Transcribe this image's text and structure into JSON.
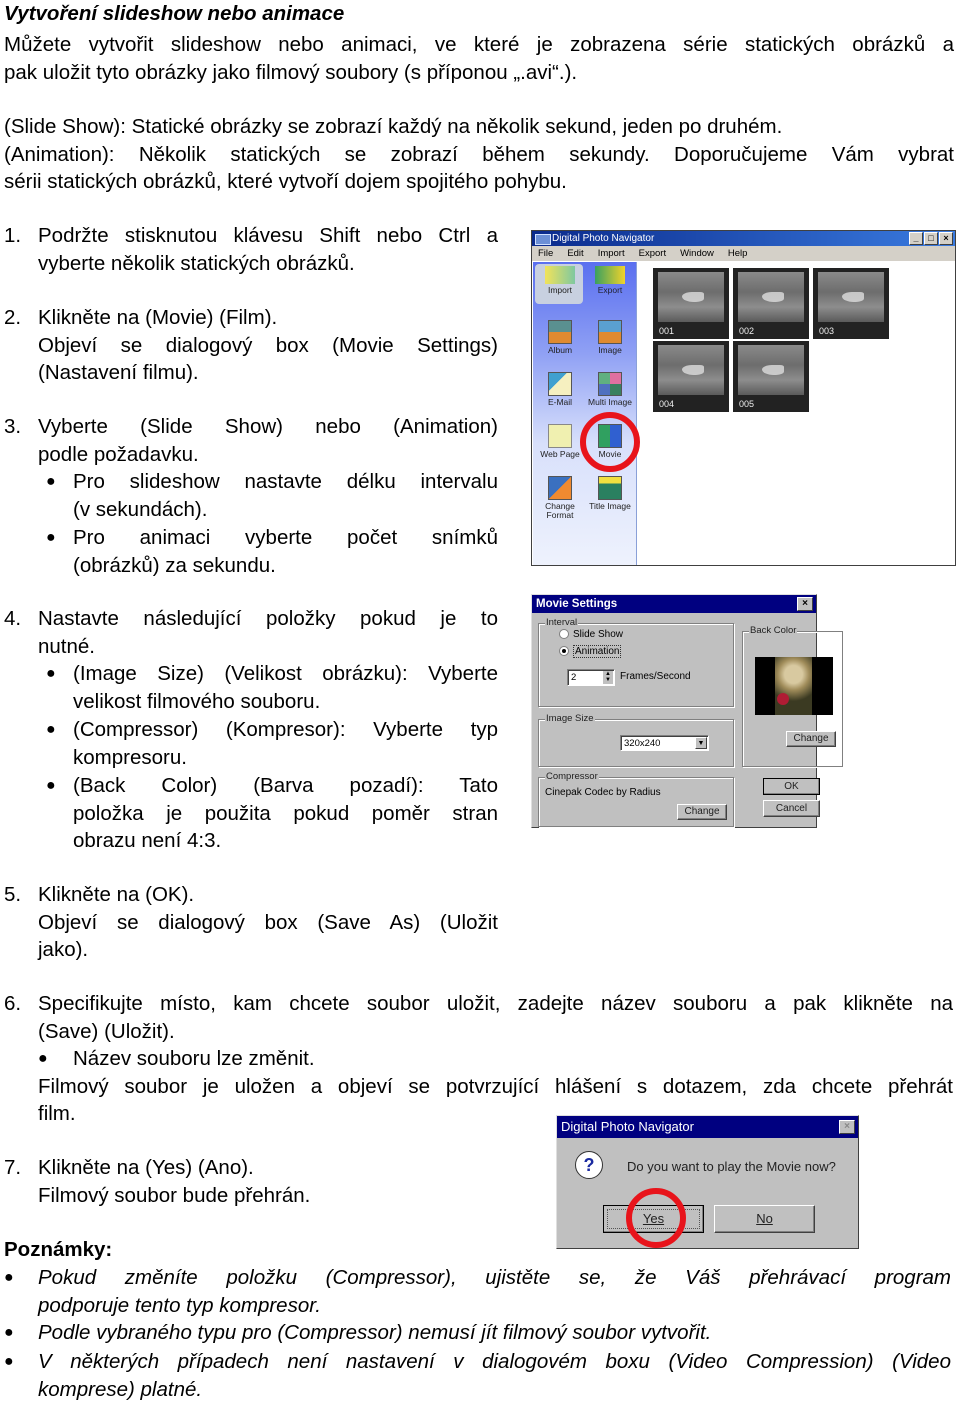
{
  "doc": {
    "title": "Vytvoření slideshow nebo animace",
    "intro_lines": [
      "Můžete vytvořit slideshow nebo animaci, ve které je zobrazena série statických obrázků a",
      "pak uložit tyto obrázky jako filmový soubory (s příponou „.avi“.)."
    ],
    "modes_lines": [
      "(Slide Show): Statické obrázky se zobrazí každý na několik sekund, jeden po druhém.",
      "(Animation): Několik statických se zobrazí během sekundy. Doporučujeme Vám vybrat",
      "sérii statických obrázků, které vytvoří dojem spojitého pohybu."
    ],
    "steps": [
      {
        "num": "1.",
        "lines": [
          "Podržte stisknutou klávesu Shift nebo Ctrl a",
          "vyberte několik statických obrázků."
        ]
      },
      {
        "num": "2.",
        "lines": [
          "Klikněte na (Movie) (Film).",
          "Objeví se dialogový box (Movie Settings)",
          "(Nastavení filmu)."
        ]
      },
      {
        "num": "3.",
        "lines": [
          "Vyberte (Slide Show) nebo (Animation)",
          "podle požadavku."
        ],
        "bullets": [
          [
            "Pro slideshow nastavte délku intervalu",
            "(v sekundách)."
          ],
          [
            "Pro animaci vyberte počet snímků",
            "(obrázků) za sekundu."
          ]
        ]
      },
      {
        "num": "4.",
        "lines": [
          "Nastavte následující položky pokud je to",
          "nutné."
        ],
        "bullets": [
          [
            "(Image Size) (Velikost obrázku): Vyberte",
            "velikost filmového souboru."
          ],
          [
            "(Compressor) (Kompresor): Vyberte typ",
            "kompresoru."
          ],
          [
            "(Back Color) (Barva pozadí): Tato",
            "položka je použita pokud poměr stran",
            "obrazu není 4:3."
          ]
        ]
      },
      {
        "num": "5.",
        "lines": [
          "Klikněte na (OK).",
          "Objeví se dialogový box (Save As) (Uložit",
          "jako)."
        ]
      },
      {
        "num": "6.",
        "lines": [
          "Specifikujte místo, kam chcete soubor uložit, zadejte název souboru a pak klikněte na",
          "(Save) (Uložit)."
        ],
        "bullets": [
          [
            "Název souboru lze změnit."
          ]
        ],
        "after": [
          "Filmový soubor je uložen a objeví se potvrzující hlášení s dotazem, zda chcete přehrát",
          "film."
        ]
      },
      {
        "num": "7.",
        "lines": [
          "Klikněte na (Yes) (Ano).",
          "Filmový soubor bude přehrán."
        ]
      }
    ],
    "notes_heading": "Poznámky:",
    "notes": [
      [
        "Pokud změníte položku (Compressor), ujistěte se, že Váš přehrávací program",
        "podporuje tento typ kompresor."
      ],
      [
        "Podle vybraného typu pro (Compressor) nemusí jít filmový soubor vytvořit."
      ],
      [
        "V některých případech není nastavení v dialogovém boxu (Video Compression) (Video",
        "komprese) platné."
      ]
    ]
  },
  "navigator": {
    "title": "Digital Photo Navigator",
    "window_buttons": {
      "minimize": "_",
      "maximize": "□",
      "close": "×"
    },
    "menu": [
      "File",
      "Edit",
      "Import",
      "Export",
      "Window",
      "Help"
    ],
    "sidebar": [
      {
        "label": "Import",
        "icon": "import-icon"
      },
      {
        "label": "Export",
        "icon": "export-icon"
      },
      {
        "label": "Album",
        "icon": "album-icon"
      },
      {
        "label": "Image",
        "icon": "image-icon"
      },
      {
        "label": "E-Mail",
        "icon": "email-icon"
      },
      {
        "label": "Multi Image",
        "icon": "multi-image-icon"
      },
      {
        "label": "Web Page",
        "icon": "web-page-icon"
      },
      {
        "label": "Movie",
        "icon": "movie-icon",
        "highlighted": true
      },
      {
        "label": "Change Format",
        "icon": "change-format-icon"
      },
      {
        "label": "Title Image",
        "icon": "title-image-icon"
      }
    ],
    "thumbnails": [
      "001",
      "002",
      "003",
      "004",
      "005"
    ]
  },
  "movie_settings": {
    "title": "Movie Settings",
    "close": "×",
    "interval_label": "Interval",
    "radio_slideshow": "Slide Show",
    "radio_animation": "Animation",
    "selected": "Animation",
    "fps_value": "2",
    "fps_label": "Frames/Second",
    "image_size_label": "Image Size",
    "image_size_value": "320x240",
    "back_color_label": "Back Color",
    "back_color_change": "Change",
    "compressor_label": "Compressor",
    "compressor_value": "Cinepak Codec by Radius",
    "compressor_change": "Change",
    "ok": "OK",
    "cancel": "Cancel"
  },
  "confirm_dialog": {
    "title": "Digital Photo Navigator",
    "close": "×",
    "message": "Do you want to play the Movie now?",
    "yes": "Yes",
    "no": "No"
  },
  "colors": {
    "highlight_circle": "#e8141b",
    "win98_title": "#000080",
    "xp_title": "#0a2a8c"
  }
}
